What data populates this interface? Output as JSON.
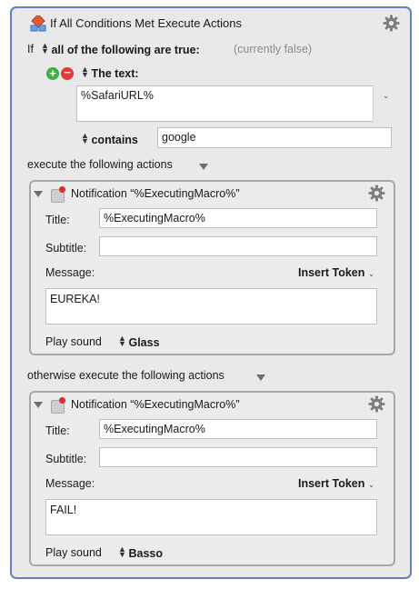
{
  "header": {
    "title": "If All Conditions Met Execute Actions"
  },
  "condition": {
    "if_label": "If",
    "mode": "all of the following are true:",
    "status": "(currently false)",
    "type_label": "The text:",
    "text_value": "%SafariURL%",
    "operator": "contains",
    "operator_value": "google"
  },
  "then_label": "execute the following actions",
  "else_label": "otherwise execute the following actions",
  "actions": [
    {
      "name": "Notification “%ExecutingMacro%”",
      "title_label": "Title:",
      "title_value": "%ExecutingMacro%",
      "subtitle_label": "Subtitle:",
      "subtitle_value": "",
      "message_label": "Message:",
      "insert_token": "Insert Token",
      "message_value": "EUREKA!",
      "sound_label": "Play sound",
      "sound_value": "Glass"
    },
    {
      "name": "Notification “%ExecutingMacro%”",
      "title_label": "Title:",
      "title_value": "%ExecutingMacro%",
      "subtitle_label": "Subtitle:",
      "subtitle_value": "",
      "message_label": "Message:",
      "insert_token": "Insert Token",
      "message_value": "FAIL!",
      "sound_label": "Play sound",
      "sound_value": "Basso"
    }
  ],
  "colors": {
    "outer_border": "#5f7fc6",
    "panel_bg": "#e9e9e9",
    "add_green": "#3cb043",
    "remove_red": "#e23b3b",
    "badge_red": "#e02a2a"
  },
  "icons": [
    "disclosure-triangle-icon",
    "if-then-action-icon",
    "gear-icon",
    "add-icon",
    "remove-icon",
    "stepper-icon",
    "notification-icon",
    "chevron-down-icon"
  ]
}
